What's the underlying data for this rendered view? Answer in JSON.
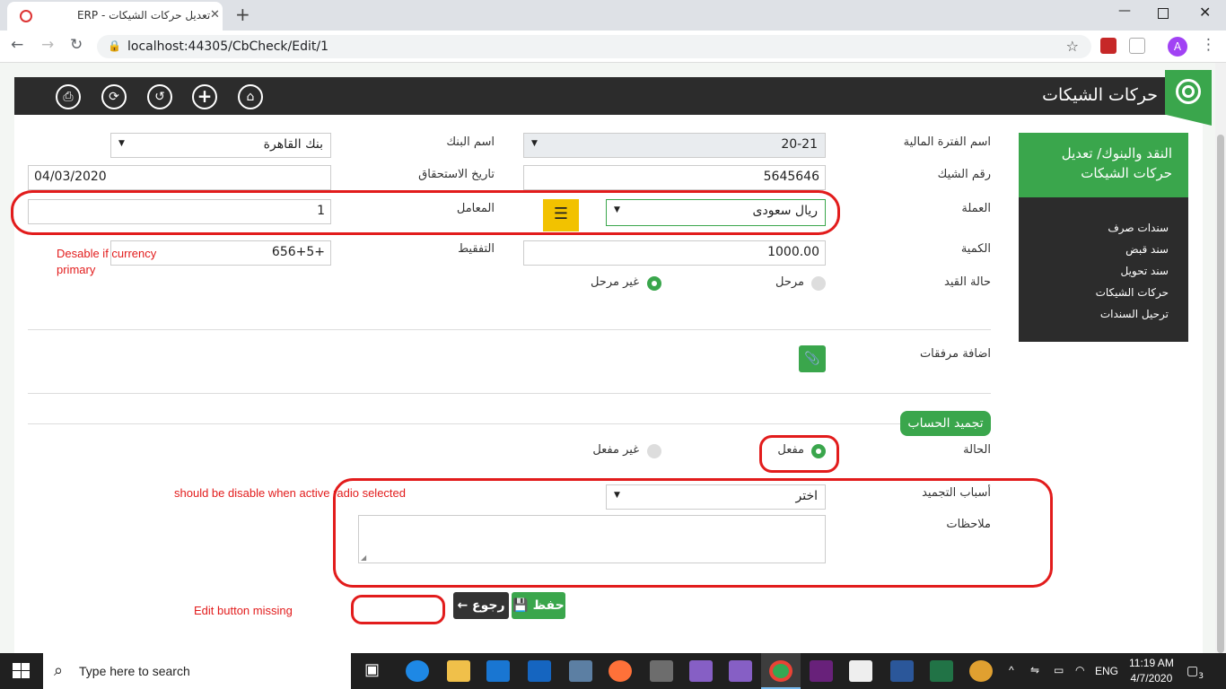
{
  "browser": {
    "tab_title": "تعديل حركات الشيكات - ERP",
    "url": "localhost:44305/CbCheck/Edit/1",
    "profile_initial": "A"
  },
  "header": {
    "title": "حركات الشيكات",
    "toolbar_icons": [
      "print-icon",
      "refresh-icon",
      "undo-icon",
      "add-icon",
      "home-icon"
    ]
  },
  "sidebar": {
    "heading": "النقد والبنوك/ تعديل حركات الشيكات",
    "items": [
      {
        "label": "سندات صرف"
      },
      {
        "label": "سند قبض"
      },
      {
        "label": "سند تحويل"
      },
      {
        "label": "حركات الشيكات"
      },
      {
        "label": "ترحيل السندات"
      }
    ]
  },
  "form": {
    "fiscal_period_label": "اسم الفترة المالية",
    "fiscal_period_value": "20-21",
    "bank_label": "اسم البنك",
    "bank_value": "بنك القاهرة",
    "check_no_label": "رقم الشيك",
    "check_no_value": "5645646",
    "due_date_label": "تاريخ الاستحقاق",
    "due_date_value": "04/03/2020",
    "currency_label": "العملة",
    "currency_value": "ريال سعودى",
    "rate_label": "المعامل",
    "rate_value": "1",
    "amount_label": "الكمية",
    "amount_value": "1000.00",
    "tafqeet_label": "التفقيط",
    "tafqeet_value": "+656+5",
    "posting_status_label": "حالة القيد",
    "posted_label": "مرحل",
    "not_posted_label": "غير مرحل",
    "attachments_label": "اضافة مرفقات"
  },
  "freeze": {
    "section_title": "تجميد الحساب",
    "status_label": "الحالة",
    "active_label": "مفعل",
    "inactive_label": "غير مفعل",
    "reasons_label": "أسباب التجميد",
    "reasons_value": "اختر",
    "notes_label": "ملاحظات",
    "notes_value": ""
  },
  "buttons": {
    "save_label": "حفظ",
    "back_label": "رجوع"
  },
  "annotations": {
    "currency_note_line1": "Desable if currency",
    "currency_note_line2": "primary",
    "disable_note": "should be disable when active radio selected",
    "edit_missing_note": "Edit button missing"
  },
  "taskbar": {
    "search_placeholder": "Type here to search",
    "language": "ENG",
    "time": "11:19 AM",
    "date": "4/7/2020",
    "notifications_count": "3"
  },
  "colors": {
    "brand_green": "#3aa64c",
    "header_dark": "#2c2c2c",
    "menu_yellow": "#f2c200",
    "annotation_red": "#e21c1c"
  }
}
